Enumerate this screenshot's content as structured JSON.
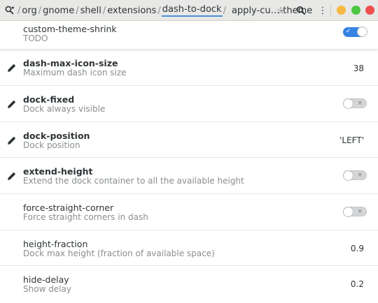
{
  "header": {
    "crumbs": [
      "/",
      "org",
      "/",
      "gnome",
      "/",
      "shell",
      "/",
      "extensions",
      "/",
      "dash-to-dock",
      "/"
    ],
    "extra": "apply-cu…-theme",
    "icons": [
      "path-icon",
      "star-icon",
      "search-icon",
      "menu-icon",
      "minimize-icon",
      "maximize-icon",
      "close-icon"
    ],
    "star_glyph": "☆",
    "menu_glyph": "⋮"
  },
  "rows": [
    {
      "key": "custom-theme-shrink",
      "summary": "TODO",
      "control": "switch",
      "state": "on",
      "edited": false
    },
    {
      "key": "dash-max-icon-size",
      "summary": "Maximum dash icon size",
      "value": "38",
      "edited": true
    },
    {
      "key": "dock-fixed",
      "summary": "Dock always visible",
      "control": "switch",
      "state": "off",
      "edited": true
    },
    {
      "key": "dock-position",
      "summary": "Dock position",
      "value": "'LEFT'",
      "edited": true
    },
    {
      "key": "extend-height",
      "summary": "Extend the dock container to all the available height",
      "control": "switch",
      "state": "off",
      "edited": true
    },
    {
      "key": "force-straight-corner",
      "summary": "Force straight corners in dash",
      "control": "switch",
      "state": "off",
      "edited": false
    },
    {
      "key": "height-fraction",
      "summary": "Dock max height (fraction of available space)",
      "value": "0.9",
      "edited": false
    },
    {
      "key": "hide-delay",
      "summary": "Show delay",
      "value": "0.2",
      "edited": false
    }
  ],
  "switch_marks": {
    "on": "✓",
    "off": "×"
  },
  "colors": {
    "accent": "#3584e4",
    "crumb_underline": "#4a90d9",
    "minimize": "#f5b942",
    "maximize": "#4ec642",
    "close": "#ef4f4d"
  }
}
